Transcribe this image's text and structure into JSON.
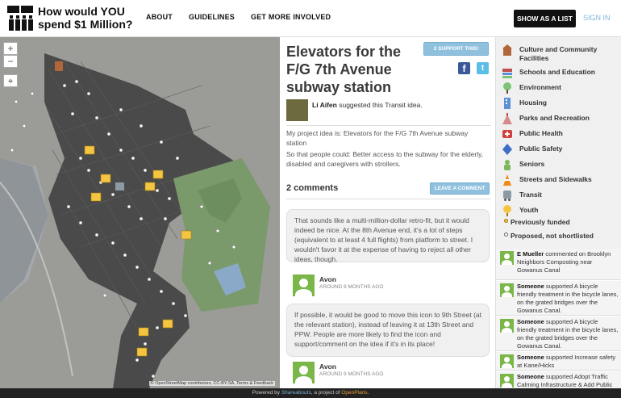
{
  "header": {
    "site_title": "How would YOU spend $1 Million?",
    "logo_text": "PB NYC",
    "nav": [
      "ABOUT",
      "GUIDELINES",
      "GET MORE INVOLVED"
    ],
    "show_list_label": "SHOW AS A LIST",
    "signin_label": "SIGN IN"
  },
  "map": {
    "zoom_in": "+",
    "zoom_out": "−",
    "locate": "⌖",
    "attribution": "© OpenStreetMap contributors, CC-BY-SA, Terms & Feedback"
  },
  "idea": {
    "close": "✕",
    "title": "Elevators for the F/G 7th Avenue subway station",
    "support_label": "2 SUPPORT THIS!",
    "author_name": "Li Aifen",
    "author_suffix": " suggested this Transit idea.",
    "description_1": "My project idea is: Elevators for the F/G 7th Avenue subway station",
    "description_2": "So that people could: Better access to the subway for the elderly, disabled and caregivers with strollers.",
    "comments_count": "2 comments",
    "leave_comment_label": "LEAVE A COMMENT"
  },
  "comments": [
    {
      "text": "That sounds like a multi-million-dollar retro-fit, but it would indeed be nice. At the 8th Avenue end, it's a lot of steps (equivalent to at least 4 full flights) from platform to street. I wouldn't favor it at the expense of having to reject all other ideas, though.",
      "author": "Avon",
      "time": "AROUND 9 MONTHS AGO"
    },
    {
      "text": "If possible, it would be good to move this icon to 9th Street (at the relevant station), instead of leaving it at 13th Street and PPW. People are more likely to find the icon and support/comment on the idea if it's in its place!",
      "author": "Avon",
      "time": "AROUND 9 MONTHS AGO"
    }
  ],
  "categories": [
    {
      "label": "Culture and Community Facilities",
      "icon": "culture-icon",
      "color": "#b0683b"
    },
    {
      "label": "Schools and Education",
      "icon": "school-icon",
      "color": "#c0504d"
    },
    {
      "label": "Environment",
      "icon": "environment-icon",
      "color": "#7cc576"
    },
    {
      "label": "Housing",
      "icon": "housing-icon",
      "color": "#5b8fd6"
    },
    {
      "label": "Parks and Recreation",
      "icon": "parks-icon",
      "color": "#d78a8a"
    },
    {
      "label": "Public Health",
      "icon": "health-icon",
      "color": "#d23f3f"
    },
    {
      "label": "Public Safety",
      "icon": "safety-icon",
      "color": "#3f6ec7"
    },
    {
      "label": "Seniors",
      "icon": "seniors-icon",
      "color": "#7bb85a"
    },
    {
      "label": "Streets and Sidewalks",
      "icon": "streets-icon",
      "color": "#f08a1c"
    },
    {
      "label": "Transit",
      "icon": "transit-icon",
      "color": "#8e9aa3"
    },
    {
      "label": "Youth",
      "icon": "youth-icon",
      "color": "#f5c542"
    }
  ],
  "legend": [
    {
      "label": "Previously funded",
      "color": "#f5c542"
    },
    {
      "label": "Proposed, not shortlisted",
      "color": "#ffffff"
    }
  ],
  "activity": [
    {
      "name": "E Mueller",
      "text": " commented on Brooklyn Neighbors Composting near Gowanus Canal"
    },
    {
      "name": "Someone",
      "text": " supported A bicycle friendly treatment in the bicycle lanes, on the grated bridges over the Gowanus Canal."
    },
    {
      "name": "Someone",
      "text": " supported A bicycle friendly treatment in the bicycle lanes, on the grated bridges over the Gowanus Canal."
    },
    {
      "name": "Someone",
      "text": " supported Increase safety at Kane/Hicks"
    },
    {
      "name": "Someone",
      "text": " supported Adopt Traffic Calming Infrastructure & Add Public"
    }
  ],
  "footer": {
    "prefix": "Powered by ",
    "brand": "Shareabouts",
    "middle": ", a project of ",
    "org": "OpenPlans",
    "suffix": "."
  },
  "colors": {
    "accent": "#8fc1df",
    "header_button": "#111111",
    "comment_avatar": "#7ab648",
    "close": "#e05a5a"
  }
}
